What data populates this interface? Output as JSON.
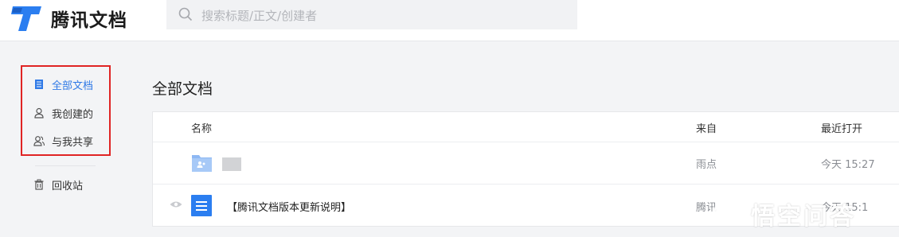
{
  "app": {
    "name": "腾讯文档"
  },
  "search": {
    "placeholder": "搜索标题/正文/创建者"
  },
  "sidebar": {
    "items": [
      {
        "label": "全部文档",
        "icon": "document-icon",
        "active": true
      },
      {
        "label": "我创建的",
        "icon": "user-icon",
        "active": false
      },
      {
        "label": "与我共享",
        "icon": "users-icon",
        "active": false
      },
      {
        "label": "回收站",
        "icon": "trash-icon",
        "active": false
      }
    ]
  },
  "main": {
    "title": "全部文档",
    "columns": {
      "name": "名称",
      "source": "来自",
      "opened": "最近打开"
    },
    "rows": [
      {
        "icon": "shared-folder-icon",
        "name": "",
        "source": "雨点",
        "opened": "今天 15:27"
      },
      {
        "icon": "doc-icon",
        "name": "【腾讯文档版本更新说明】",
        "source": "腾讯",
        "opened": "今天 15:1"
      }
    ]
  },
  "watermark": {
    "text": "悟空问答"
  },
  "colors": {
    "accent": "#2f79e6",
    "highlight_border": "#e02424",
    "doc_icon": "#2b7ef0"
  }
}
